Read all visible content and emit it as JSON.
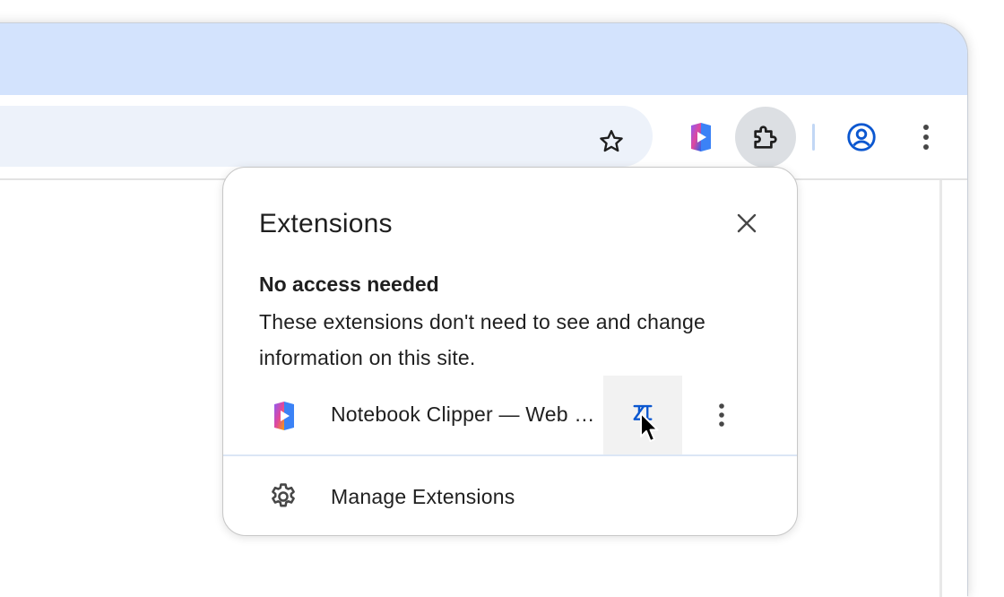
{
  "toolbar": {
    "bookmark_icon": "star-outline-icon",
    "pinned_extension_icon": "notebook-clipper-icon",
    "extensions_icon": "puzzle-piece-icon",
    "profile_icon": "account-circle-icon",
    "menu_icon": "kebab-menu-icon"
  },
  "popup": {
    "title": "Extensions",
    "close_icon": "close-icon",
    "section": {
      "heading": "No access needed",
      "description": "These extensions don't need to see and change information on this site."
    },
    "extensions": [
      {
        "name": "Notebook Clipper — Web Clipper",
        "icon": "notebook-clipper-icon",
        "pin_icon": "pin-icon",
        "more_icon": "kebab-menu-icon"
      }
    ],
    "footer": {
      "manage_label": "Manage Extensions",
      "manage_icon": "gear-icon"
    }
  },
  "colors": {
    "tabstrip": "#d3e3fd",
    "omnibox": "#edf2fa",
    "accent": "#0b57d0",
    "text": "#1f1f1f",
    "icon": "#474747"
  }
}
